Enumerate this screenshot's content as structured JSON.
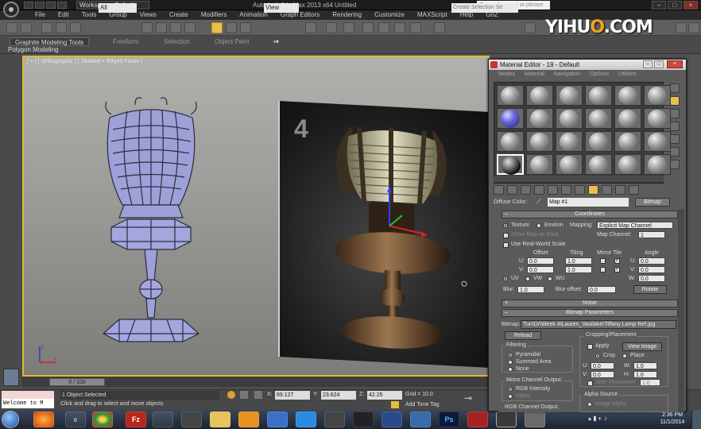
{
  "app": {
    "workspace": "Workspace: Default",
    "window_title": "Autodesk 3ds Max 2013 x64    Untitled",
    "search_placeholder": "Type a keyword or phrase",
    "watermark_left": "YIHU",
    "watermark_o": "O",
    "watermark_right": ".COM"
  },
  "menu": [
    "File",
    "Edit",
    "Tools",
    "Group",
    "Views",
    "Create",
    "Modifiers",
    "Animation",
    "Graph Editors",
    "Rendering",
    "Customize",
    "MAXScript",
    "Help",
    "GoZ"
  ],
  "toolbar": {
    "selection_filter": "All",
    "reference_coord": "View",
    "named_selection": "Create Selection Se"
  },
  "ribbon": {
    "tabs": [
      "Graphite Modeling Tools",
      "Freeform",
      "Selection",
      "Object Paint"
    ],
    "panel_label": "Polygon Modeling"
  },
  "viewport": {
    "label": "[ + ] [ Orthographic ] [ Shaded + Edged Faces ]",
    "reference_number": "4"
  },
  "timeline": {
    "slider": "0 / 100"
  },
  "status": {
    "maxscript_text": "Welcome to M",
    "selection": "1 Object Selected",
    "prompt": "Click and drag to select and move objects",
    "x_label": "X:",
    "x": "69.127",
    "y_label": "Y:",
    "y": "23.624",
    "z_label": "Z:",
    "z": "42.25",
    "grid": "Grid = 10.0",
    "add_time_tag": "Add Time Tag"
  },
  "taskbar": {
    "apps": [
      "e",
      "",
      "",
      "Fz",
      "",
      "",
      "",
      "",
      "",
      "",
      "",
      "Ps",
      "",
      ""
    ],
    "time": "2:36 PM",
    "date": "11/1/2014"
  },
  "material_editor": {
    "title": "Material Editor - 19 - Default",
    "menu": [
      "Modes",
      "Material",
      "Navigation",
      "Options",
      "Utilities"
    ],
    "diffuse_label": "Diffuse Color:",
    "map_name": "Map #1",
    "map_type": "Bitmap",
    "coordinates": {
      "title": "Coordinates",
      "texture": "Texture",
      "environ": "Environ",
      "mapping_label": "Mapping:",
      "mapping": "Explicit Map Channel",
      "show_map": "Show Map on Back",
      "map_channel_label": "Map Channel:",
      "map_channel": "1",
      "real_world": "Use Real-World Scale",
      "offset": "Offset",
      "tiling": "Tiling",
      "mirror_tile": "Mirror Tile",
      "angle": "Angle",
      "u_label": "U:",
      "v_label": "V:",
      "w_label": "W:",
      "u_offset": "0.0",
      "v_offset": "0.0",
      "u_tiling": "1.0",
      "v_tiling": "1.0",
      "u_angle": "0.0",
      "v_angle": "0.0",
      "w_angle": "0.0",
      "uv": "UV",
      "vw": "VW",
      "wu": "WU",
      "blur_label": "Blur:",
      "blur": "1.0",
      "blur_offset_label": "Blur offset:",
      "blur_offset": "0.0",
      "rotate": "Rotate"
    },
    "noise": "Noise",
    "bitmap_params": {
      "title": "Bitmap Parameters",
      "bitmap_label": "Bitmap:",
      "path": "Tun\\Dr\\Week 4\\Lauren_Vasilake\\Tiffany Lamp Ref.jpg",
      "reload": "Reload",
      "cropping": "Cropping/Placement",
      "apply": "Apply",
      "view_image": "View Image",
      "crop": "Crop",
      "place": "Place",
      "u_label": "U:",
      "v_label": "V:",
      "w_label": "W:",
      "h_label": "H:",
      "u": "0.0",
      "v": "0.0",
      "w": "1.0",
      "h": "1.0",
      "jitter": "Jitter Placement",
      "jitter_val": "1.0",
      "filtering": "Filtering",
      "pyramidal": "Pyramidal",
      "summed": "Summed Area",
      "none": "None",
      "mono_output": "Mono Channel Output:",
      "rgb_intensity": "RGB Intensity",
      "alpha": "Alpha",
      "rgb_output": "RGB Channel Output:",
      "alpha_source": "Alpha Source",
      "image_alpha": "Image Alpha"
    }
  }
}
